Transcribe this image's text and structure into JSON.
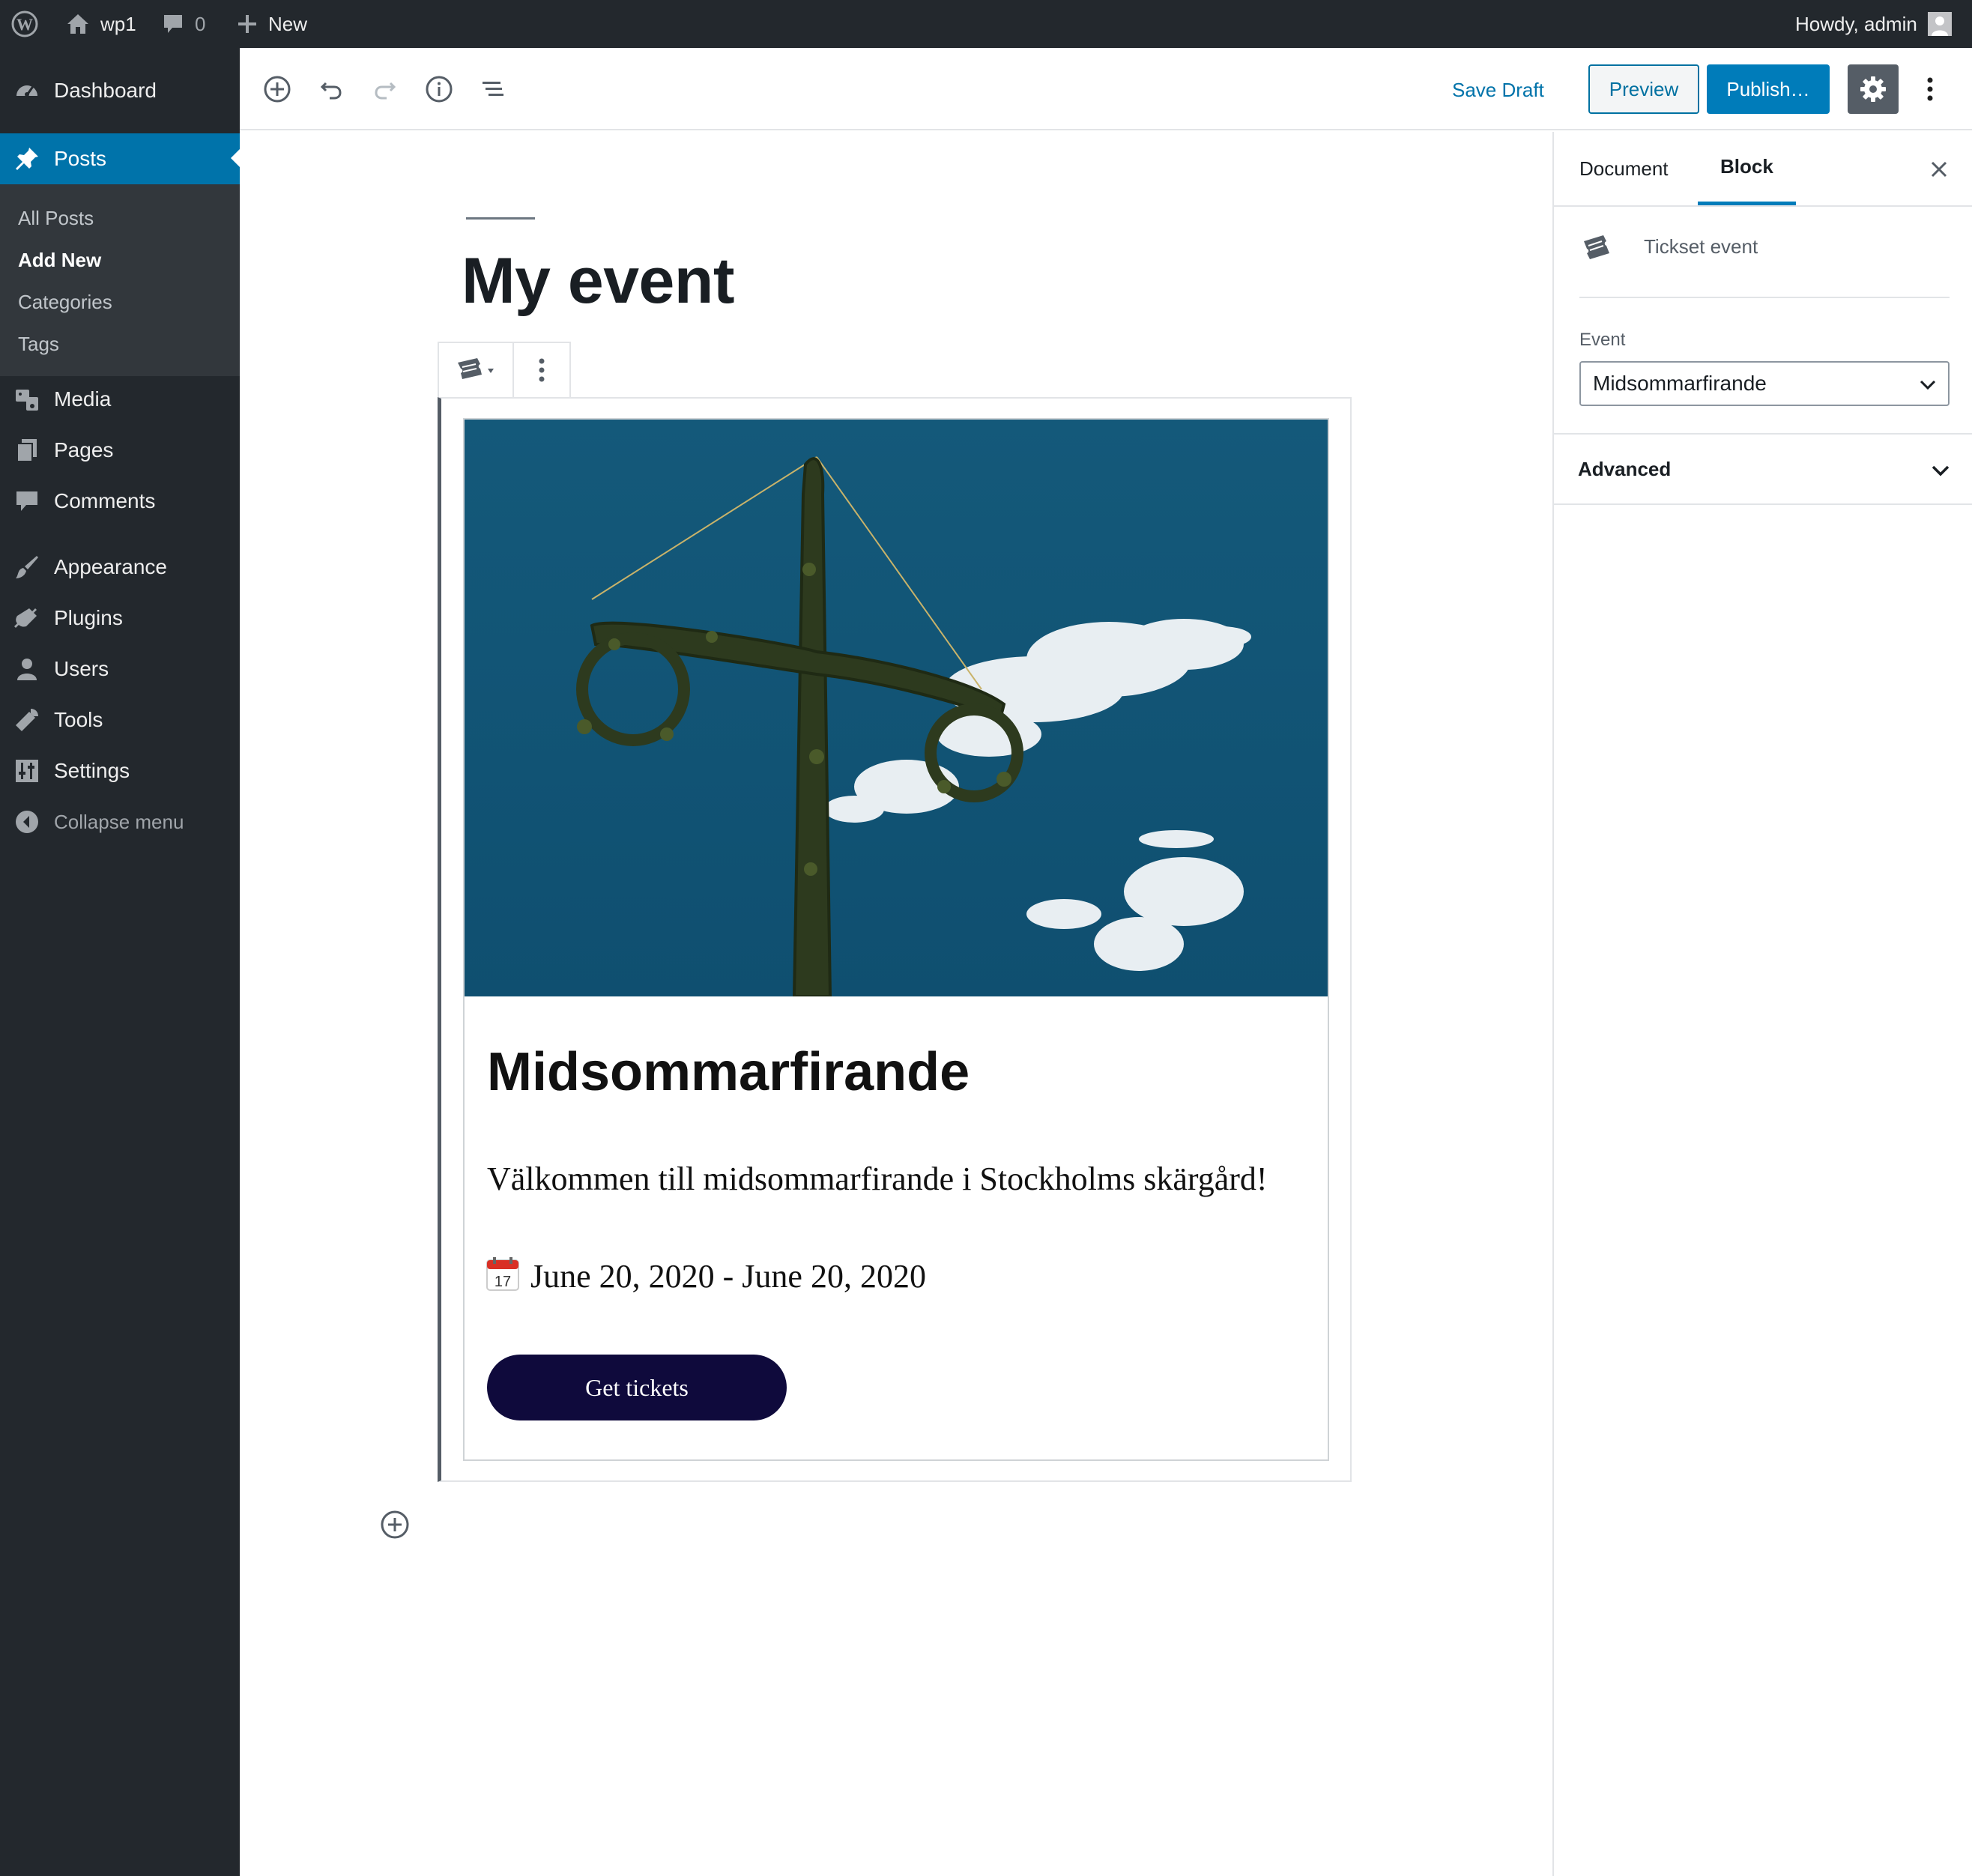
{
  "admin_bar": {
    "site_name": "wp1",
    "comments_count": "0",
    "new_label": "New",
    "greeting": "Howdy, admin"
  },
  "sidebar": {
    "dashboard": "Dashboard",
    "posts": "Posts",
    "posts_submenu": [
      "All Posts",
      "Add New",
      "Categories",
      "Tags"
    ],
    "media": "Media",
    "pages": "Pages",
    "comments": "Comments",
    "appearance": "Appearance",
    "plugins": "Plugins",
    "users": "Users",
    "tools": "Tools",
    "settings": "Settings",
    "collapse": "Collapse menu",
    "active_color": "#0073aa"
  },
  "header": {
    "save_draft": "Save Draft",
    "preview": "Preview",
    "publish": "Publish…",
    "icons": [
      "add-block-icon",
      "undo-icon",
      "redo-icon",
      "info-icon",
      "outline-icon",
      "gear-icon",
      "more-vertical-icon"
    ]
  },
  "editor": {
    "post_title": "My event",
    "event": {
      "name": "Midsommarfirande",
      "description": "Välkommen till midsommarfirande i Stockholms skärgård!",
      "calendar_day": "17",
      "dates": "June 20, 2020 - June 20, 2020",
      "button_label": "Get tickets",
      "button_color": "#0f0a3c"
    }
  },
  "settings_sidebar": {
    "tabs": [
      "Document",
      "Block"
    ],
    "active_tab": "Block",
    "block_name": "Tickset event",
    "event_label": "Event",
    "event_selected": "Midsommarfirande",
    "advanced_label": "Advanced"
  }
}
